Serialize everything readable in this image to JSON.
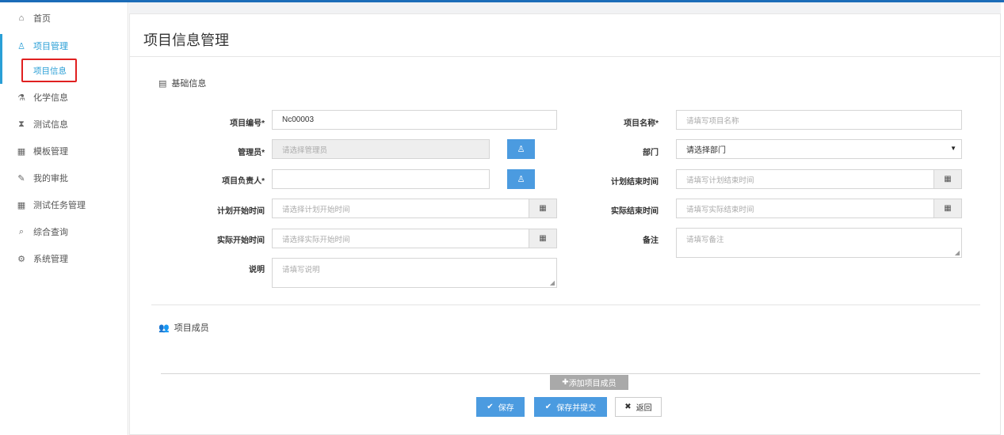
{
  "sidebar": {
    "items": [
      {
        "label": "首页",
        "icon": "home-icon",
        "glyph": "⌂"
      },
      {
        "label": "项目管理",
        "icon": "user-icon",
        "glyph": "♙"
      },
      {
        "label": "化学信息",
        "icon": "flask-icon",
        "glyph": "⚗"
      },
      {
        "label": "测试信息",
        "icon": "hourglass-icon",
        "glyph": "⧗"
      },
      {
        "label": "模板管理",
        "icon": "calendar-icon",
        "glyph": "▦"
      },
      {
        "label": "我的审批",
        "icon": "edit-icon",
        "glyph": "✎"
      },
      {
        "label": "测试任务管理",
        "icon": "calendar-grid-icon",
        "glyph": "▦"
      },
      {
        "label": "综合查询",
        "icon": "search-icon",
        "glyph": "⌕"
      },
      {
        "label": "系统管理",
        "icon": "gear-icon",
        "glyph": "⚙"
      }
    ],
    "sub_item": "项目信息"
  },
  "page": {
    "title": "项目信息管理"
  },
  "basic": {
    "heading": "基础信息",
    "project_no_label": "项目编号*",
    "project_no_value": "Nc00003",
    "project_name_label": "项目名称*",
    "project_name_placeholder": "请填写项目名称",
    "manager_label": "管理员*",
    "manager_placeholder": "请选择管理员",
    "dept_label": "部门",
    "dept_value": "请选择部门",
    "owner_label": "项目负责人*",
    "plan_end_label": "计划结束时间",
    "plan_end_placeholder": "请填写计划结束时间",
    "plan_start_label": "计划开始时间",
    "plan_start_placeholder": "请选择计划开始时间",
    "actual_end_label": "实际结束时间",
    "actual_end_placeholder": "请填写实际结束时间",
    "actual_start_label": "实际开始时间",
    "actual_start_placeholder": "请选择实际开始时间",
    "remark_label": "备注",
    "remark_placeholder": "请填写备注",
    "desc_label": "说明",
    "desc_placeholder": "请填写说明"
  },
  "members": {
    "heading": "项目成员",
    "add_label": "添加项目成员"
  },
  "actions": {
    "save": "保存",
    "save_submit": "保存并提交",
    "back": "返回"
  },
  "colors": {
    "primary": "#4b9be0",
    "active_nav": "#2a9fd6",
    "highlight_box": "#e02020"
  }
}
